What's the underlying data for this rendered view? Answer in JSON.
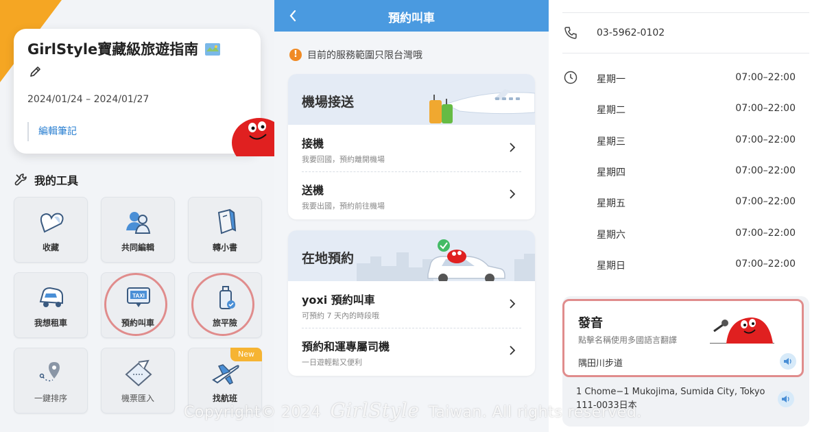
{
  "left_panel": {
    "trip_card": {
      "title": "GirlStyle寶藏級旅遊指南",
      "dates": "2024/01/24 – 2024/01/27",
      "edit_note": "編輯筆記"
    },
    "tools_title": "我的工具",
    "tools": [
      {
        "label": "收藏",
        "icon": "heart-icon"
      },
      {
        "label": "共同編輯",
        "icon": "people-icon"
      },
      {
        "label": "轉小書",
        "icon": "book-icon"
      },
      {
        "label": "我想租車",
        "icon": "car-icon"
      },
      {
        "label": "預約叫車",
        "icon": "taxi-icon"
      },
      {
        "label": "旅平險",
        "icon": "insurance-icon"
      },
      {
        "label": "一鍵排序",
        "icon": "route-icon"
      },
      {
        "label": "機票匯入",
        "icon": "ticket-icon"
      },
      {
        "label": "找航班",
        "icon": "airplane-icon"
      }
    ],
    "new_badge": "New",
    "taxi_sign": "TAXI"
  },
  "middle_panel": {
    "nav_title": "預約叫車",
    "notice": "目前的服務範圍只限台灣哦",
    "notice_icon": "!",
    "airport_section": {
      "title": "機場接送",
      "items": [
        {
          "title": "接機",
          "sub": "我要回國，預約離開機場"
        },
        {
          "title": "送機",
          "sub": "我要出國，預約前往機場"
        }
      ]
    },
    "local_section": {
      "title": "在地預約",
      "items": [
        {
          "title": "yoxi 預約叫車",
          "sub": "可預約 7 天內的時段哦"
        },
        {
          "title": "預約和運專屬司機",
          "sub": "一日遊輕鬆又便利"
        }
      ]
    }
  },
  "right_panel": {
    "phone": "03-5962-0102",
    "hours": [
      {
        "day": "星期一",
        "time": "07:00–22:00"
      },
      {
        "day": "星期二",
        "time": "07:00–22:00"
      },
      {
        "day": "星期三",
        "time": "07:00–22:00"
      },
      {
        "day": "星期四",
        "time": "07:00–22:00"
      },
      {
        "day": "星期五",
        "time": "07:00–22:00"
      },
      {
        "day": "星期六",
        "time": "07:00–22:00"
      },
      {
        "day": "星期日",
        "time": "07:00–22:00"
      }
    ],
    "pronunciation": {
      "title": "發音",
      "subtitle": "點擊名稱使用多國語言翻譯",
      "place_name": "隅田川步道"
    },
    "address": "1 Chome−1 Mukojima, Sumida City, Tokyo 111-0033日本"
  },
  "watermark": {
    "prefix": "Copyright© 2024",
    "brand": "GirlStyle",
    "suffix": "Taiwan. All rights reserved."
  },
  "colors": {
    "accent_blue": "#4a9ae0",
    "highlight_ring": "#e08c8c",
    "corner_orange": "#f5a623",
    "mascot_red": "#e02020",
    "link_blue": "#2a7fd1"
  }
}
